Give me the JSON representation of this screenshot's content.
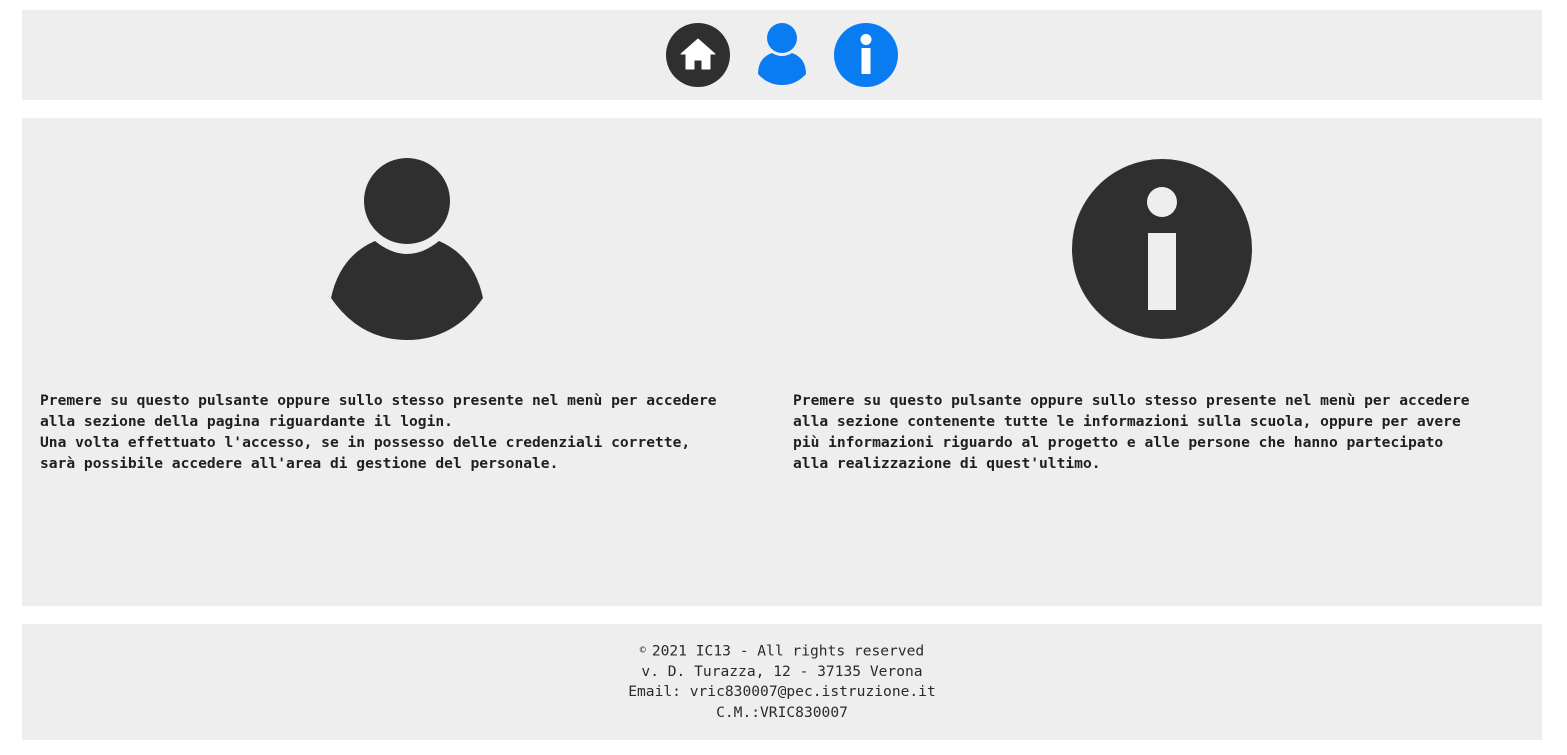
{
  "navbar": {
    "items": [
      {
        "icon": "home-icon",
        "color": "#2f2f2f"
      },
      {
        "icon": "user-icon",
        "color": "#0a7cf2"
      },
      {
        "icon": "info-icon",
        "color": "#0a7cf2"
      }
    ]
  },
  "main": {
    "login_card": {
      "icon": "user-icon",
      "description": "Premere su questo pulsante oppure sullo stesso presente nel menù per accedere\nalla sezione della pagina riguardante il login.\nUna volta effettuato l'accesso, se in possesso delle credenziali corrette,\nsarà possibile accedere all'area di gestione del personale."
    },
    "info_card": {
      "icon": "info-icon",
      "description": "Premere su questo pulsante oppure sullo stesso presente nel menù per accedere\nalla sezione contenente tutte le informazioni sulla scuola, oppure per avere\npiù informazioni riguardo al progetto e alle persone che hanno partecipato\nalla realizzazione di quest'ultimo."
    },
    "icon_color": "#2f2f2f"
  },
  "footer": {
    "copyright_symbol": "©",
    "copyright": "2021 IC13 - All rights reserved",
    "address": "v. D. Turazza, 12 - 37135 Verona",
    "email": "Email: vric830007@pec.istruzione.it",
    "code": "C.M.:VRIC830007"
  }
}
